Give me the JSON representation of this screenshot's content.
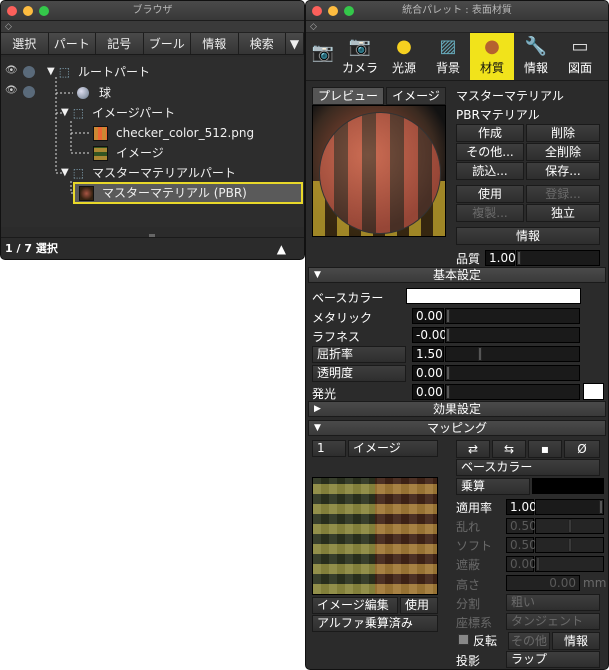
{
  "browser": {
    "title": "ブラウザ",
    "tabs": [
      "選択",
      "パート",
      "記号",
      "ブール",
      "情報",
      "検索",
      "▼"
    ],
    "tree": [
      {
        "label": "ルートパート"
      },
      {
        "label": "球"
      },
      {
        "label": "イメージパート"
      },
      {
        "label": "checker_color_512.png"
      },
      {
        "label": "イメージ"
      },
      {
        "label": "マスターマテリアルパート"
      },
      {
        "label": "マスターマテリアル (PBR)"
      }
    ],
    "status": "1 / 7 選択",
    "status_arrow": "▲"
  },
  "palette": {
    "title": "統合パレット : 表面材質",
    "tabs": [
      {
        "label": "",
        "icon": "camera-snapshot-icon"
      },
      {
        "label": "カメラ",
        "icon": "camera-icon"
      },
      {
        "label": "光源",
        "icon": "sun-icon"
      },
      {
        "label": "背景",
        "icon": "landscape-icon"
      },
      {
        "label": "材質",
        "icon": "sphere-icon"
      },
      {
        "label": "情報",
        "icon": "wrench-icon"
      },
      {
        "label": "図面",
        "icon": "ruler-icon"
      }
    ],
    "preview_tabs": [
      "プレビュー",
      "イメージ"
    ],
    "material_name": "マスターマテリアル",
    "material_type": "PBRマテリアル",
    "buttons": {
      "create": "作成",
      "delete": "削除",
      "other": "その他...",
      "delete_all": "全削除",
      "load": "読込...",
      "save": "保存...",
      "use": "使用",
      "register": "登録...",
      "duplicate": "複製...",
      "independent": "独立",
      "info": "情報"
    },
    "quality_label": "品質",
    "quality_value": "1.00",
    "basic_section": "基本設定",
    "base_color_label": "ベースカラー",
    "metallic_label": "メタリック",
    "metallic_value": "0.00",
    "roughness_label": "ラフネス",
    "roughness_value": "-0.00",
    "refraction_label": "屈折率",
    "refraction_value": "1.50",
    "transparency_label": "透明度",
    "transparency_value": "0.00",
    "emission_label": "発光",
    "emission_value": "0.00",
    "effects_section": "効果設定",
    "mapping_section": "マッピング",
    "mapping": {
      "index": "1",
      "type": "イメージ",
      "target": "ベースカラー",
      "blend": "乗算",
      "apply_label": "適用率",
      "apply_value": "1.00",
      "noise_label": "乱れ",
      "noise_value": "0.50",
      "soft_label": "ソフト",
      "soft_value": "0.50",
      "shield_label": "遮蔽",
      "shield_value": "0.00",
      "height_label": "高さ",
      "height_value": "0.00",
      "height_unit": "mm",
      "divide_label": "分割",
      "divide_value": "粗い",
      "coord_label": "座標系",
      "coord_value": "タンジェント",
      "invert_label": "反転",
      "other_button": "その他",
      "info_button": "情報",
      "projection_label": "投影",
      "projection_value": "ラップ",
      "image_edit": "イメージ編集",
      "use": "使用",
      "alpha": "アルファ乗算済み"
    }
  }
}
